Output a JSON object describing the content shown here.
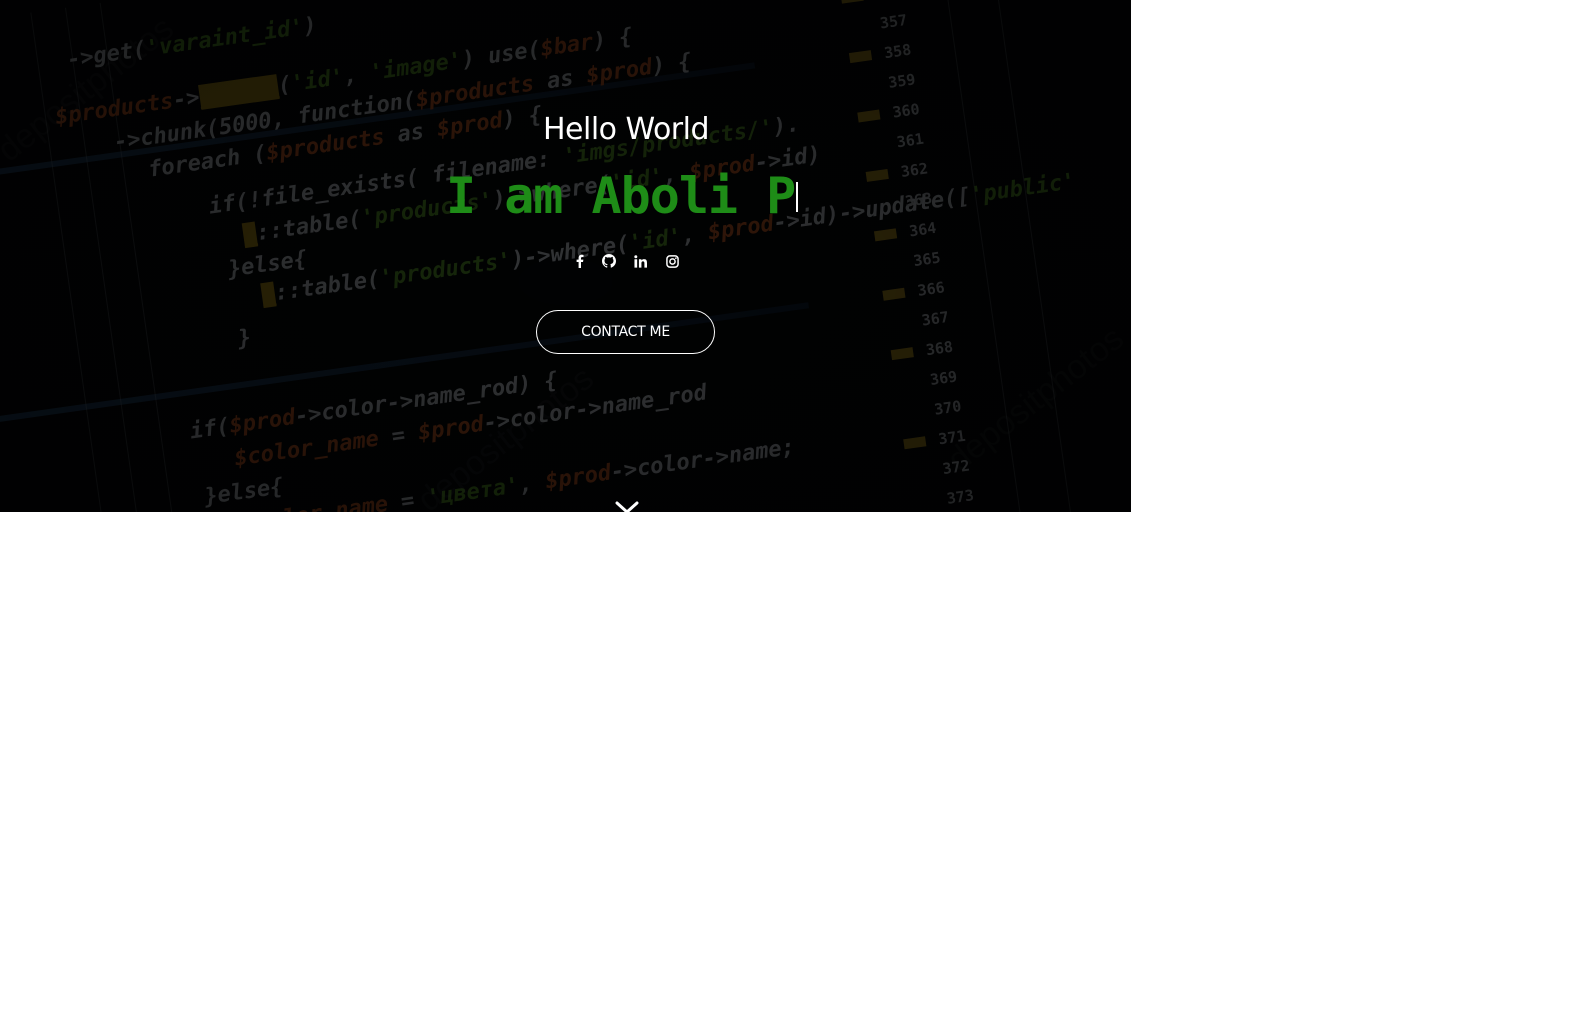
{
  "hero": {
    "greeting": "Hello World",
    "typed_text": "I am Aboli P",
    "contact_button": "CONTACT ME",
    "accent_color": "#1e8c17",
    "overlay_color": "#000000"
  },
  "social": [
    {
      "name": "facebook",
      "icon": "facebook-icon"
    },
    {
      "name": "github",
      "icon": "github-icon"
    },
    {
      "name": "linkedin",
      "icon": "linkedin-icon"
    },
    {
      "name": "instagram",
      "icon": "instagram-icon"
    }
  ],
  "scroll": {
    "icon": "chevron-down-icon"
  }
}
